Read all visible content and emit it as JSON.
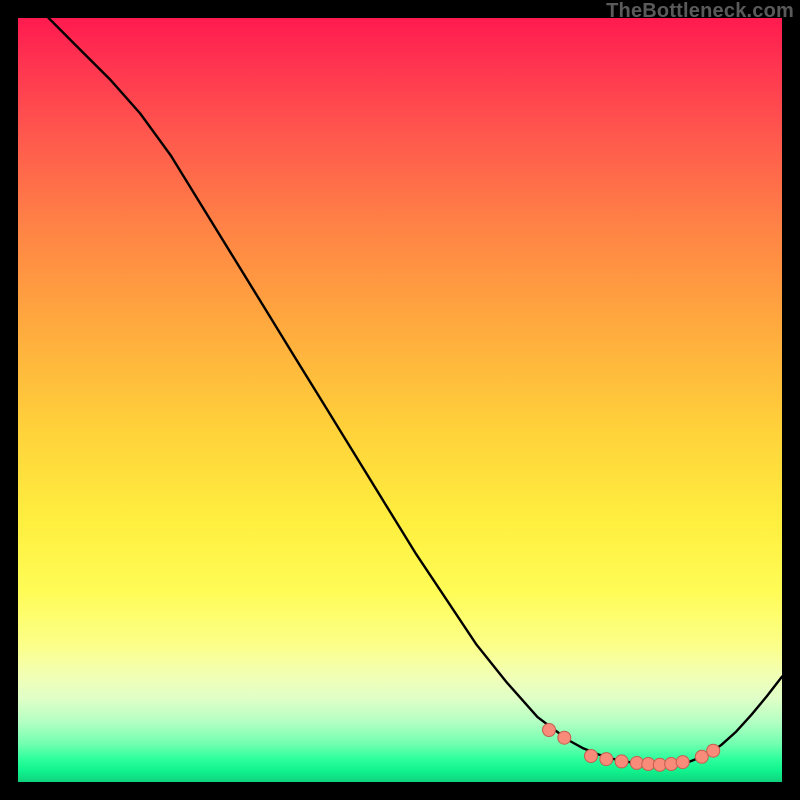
{
  "watermark": "TheBottleneck.com",
  "colors": {
    "curve": "#000000",
    "dot_fill": "#f98b7a",
    "dot_stroke": "#c45f50"
  },
  "chart_data": {
    "type": "line",
    "title": "",
    "xlabel": "",
    "ylabel": "",
    "xlim": [
      0,
      100
    ],
    "ylim": [
      0,
      100
    ],
    "series": [
      {
        "name": "curve",
        "x": [
          4,
          8,
          12,
          16,
          20,
          24,
          28,
          32,
          36,
          40,
          44,
          48,
          52,
          56,
          60,
          64,
          68,
          72,
          74,
          76,
          78,
          80,
          82,
          84,
          86,
          88,
          90,
          92,
          94,
          96,
          98,
          100
        ],
        "y": [
          100,
          96,
          92,
          87.5,
          82,
          75.5,
          69,
          62.5,
          56,
          49.5,
          43,
          36.5,
          30,
          24,
          18,
          13,
          8.5,
          5.5,
          4.4,
          3.6,
          3.0,
          2.6,
          2.3,
          2.2,
          2.3,
          2.7,
          3.5,
          4.8,
          6.6,
          8.8,
          11.2,
          13.8
        ]
      }
    ],
    "dots": {
      "name": "highlight-dots",
      "x": [
        69.5,
        71.5,
        75.0,
        77.0,
        79.0,
        81.0,
        82.5,
        84.0,
        85.5,
        87.0,
        89.5,
        91.0
      ],
      "y": [
        6.8,
        5.8,
        3.4,
        3.0,
        2.7,
        2.5,
        2.35,
        2.25,
        2.35,
        2.6,
        3.3,
        4.1
      ]
    }
  }
}
